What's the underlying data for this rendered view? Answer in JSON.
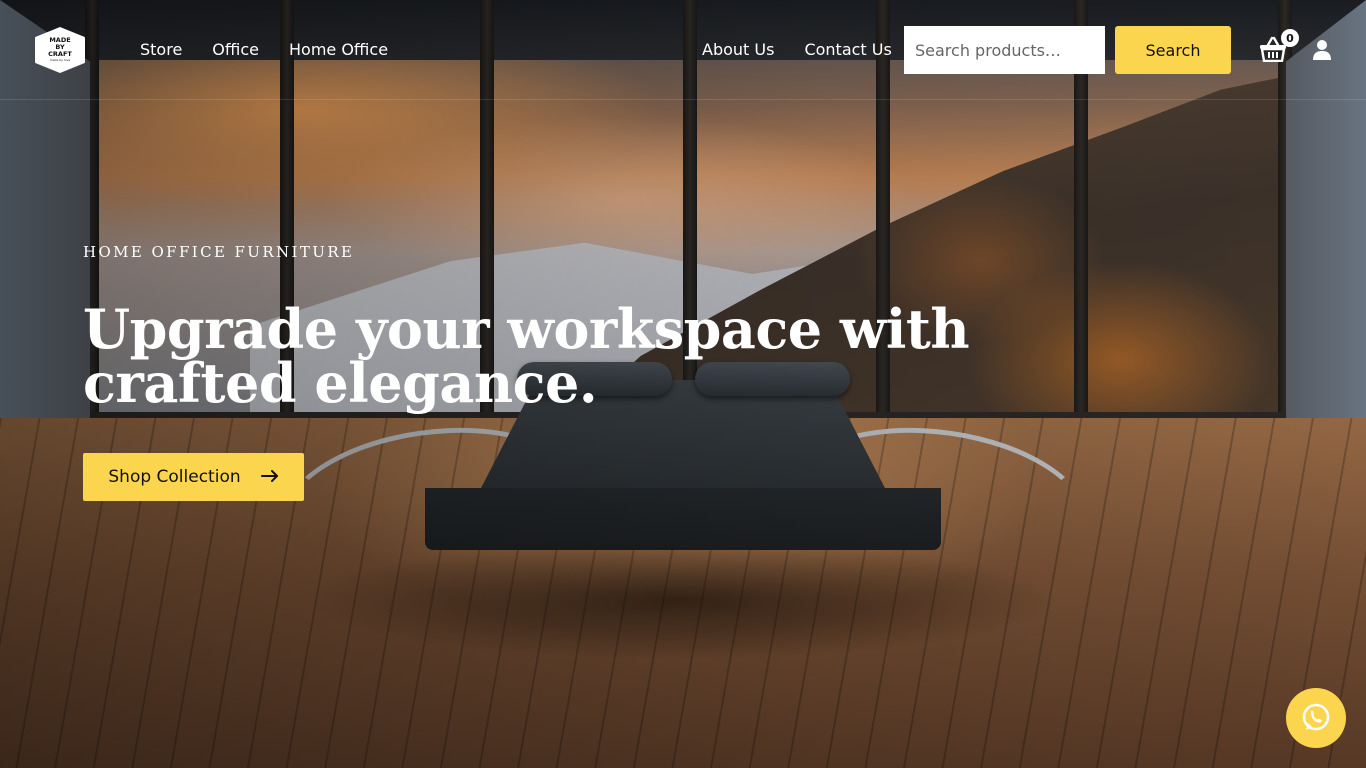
{
  "brand": {
    "logo_line1": "MADE",
    "logo_line2": "BY",
    "logo_line3": "CRAFT",
    "logo_tagline": "made by love"
  },
  "nav_left": [
    "Store",
    "Office",
    "Home Office"
  ],
  "nav_right": [
    "About Us",
    "Contact Us"
  ],
  "search": {
    "placeholder": "Search products…",
    "button_label": "Search"
  },
  "cart": {
    "count": "0",
    "icon": "basket-icon"
  },
  "account": {
    "icon": "user-icon"
  },
  "hero": {
    "eyebrow": "HOME OFFICE FURNITURE",
    "headline": "Upgrade your workspace with crafted elegance.",
    "cta_label": "Shop Collection",
    "cta_icon": "arrow-right-icon"
  },
  "floating": {
    "icon": "whatsapp-icon"
  },
  "colors": {
    "accent": "#fbd54e",
    "text_light": "#ffffff",
    "text_dark": "#111111"
  }
}
